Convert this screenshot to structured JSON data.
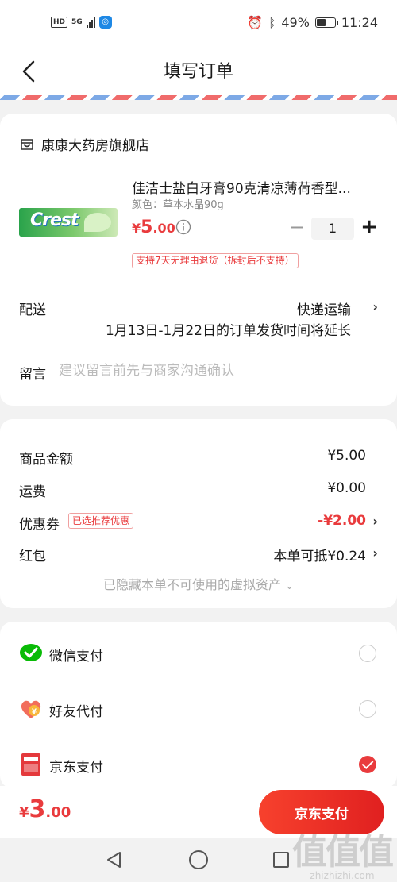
{
  "status_bar": {
    "hd": "HD",
    "network": "5G",
    "battery": "49%",
    "time": "11:24"
  },
  "header": {
    "title": "填写订单"
  },
  "store": {
    "name": "康康大药房旗舰店"
  },
  "product": {
    "thumb_text": "Crest",
    "name": "佳洁士盐白牙膏90克清凉薄荷香型...",
    "spec": "颜色：草本水晶90g",
    "price_currency": "¥",
    "price_int": "5",
    "price_dec": ".00",
    "quantity": "1",
    "return_policy": "支持7天无理由退货（拆封后不支持）"
  },
  "shipping": {
    "label": "配送",
    "method": "快递运输",
    "note": "1月13日-1月22日的订单发货时间将延长"
  },
  "message": {
    "label": "留言",
    "placeholder": "建议留言前先与商家沟通确认"
  },
  "summary": {
    "items": [
      {
        "label": "商品金额",
        "value": "¥5.00"
      },
      {
        "label": "运费",
        "value": "¥0.00"
      },
      {
        "label": "优惠券",
        "tag": "已选推荐优惠",
        "value": "-¥2.00"
      },
      {
        "label": "红包",
        "value": "本单可抵¥0.24"
      }
    ],
    "hidden_note": "已隐藏本单不可使用的虚拟资产"
  },
  "payment_methods": [
    {
      "label": "微信支付",
      "icon": "wechat-pay-icon",
      "selected": false
    },
    {
      "label": "好友代付",
      "icon": "friend-pay-icon",
      "selected": false
    },
    {
      "label": "京东支付",
      "icon": "jd-pay-icon",
      "selected": true
    }
  ],
  "pay_bar": {
    "total_currency": "¥",
    "total_int": "3",
    "total_dec": ".00",
    "button_label": "京东支付"
  },
  "watermark": {
    "mark": "值值值",
    "site": "zhizhizhi.com"
  },
  "colors": {
    "accent_red": "#e93b3d",
    "wechat_green": "#09bb07"
  }
}
